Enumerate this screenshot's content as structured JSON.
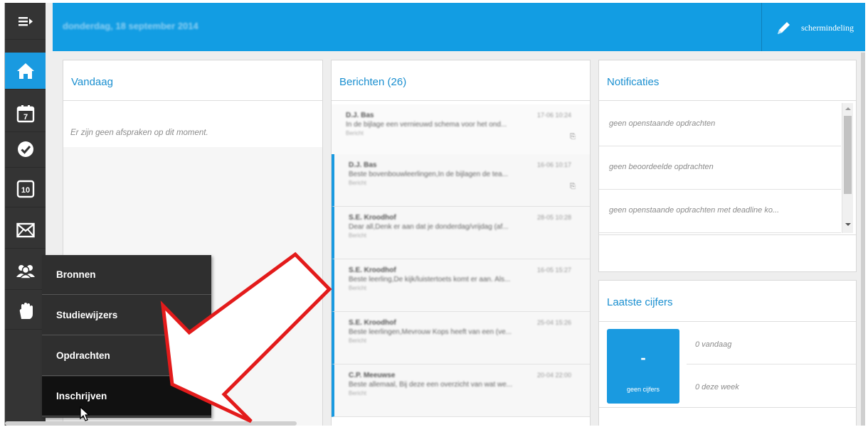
{
  "header": {
    "date": "donderdag, 18 september 2014",
    "split_label": "schermindeling"
  },
  "sidebar": {
    "items": [
      {
        "icon": "menu-expand-icon"
      },
      {
        "icon": "home-icon",
        "active": true
      },
      {
        "icon": "calendar-icon",
        "value": "7"
      },
      {
        "icon": "checkmark-icon"
      },
      {
        "icon": "grades-icon",
        "value": "10"
      },
      {
        "icon": "mail-icon"
      },
      {
        "icon": "people-icon"
      },
      {
        "icon": "hand-icon"
      }
    ]
  },
  "vandaag": {
    "title": "Vandaag",
    "empty": "Er zijn geen afspraken op dit moment."
  },
  "berichten": {
    "title": "Berichten (26)",
    "messages": [
      {
        "from": "D.J. Bas",
        "time": "17-06 10:24",
        "text": "In de bijlage een vernieuwd schema voor het ond...",
        "tag": "Bericht"
      },
      {
        "from": "D.J. Bas",
        "time": "16-06 10:17",
        "text": "Beste bovenbouwleerlingen,In de bijlagen de tea...",
        "tag": "Bericht"
      },
      {
        "from": "S.E. Kroodhof",
        "time": "28-05 10:28",
        "text": "Dear all,Denk er aan dat je donderdag/vrijdag (af...",
        "tag": "Bericht"
      },
      {
        "from": "S.E. Kroodhof",
        "time": "16-05 15:27",
        "text": "Beste leerling,De kijk/luistertoets komt er aan. Als...",
        "tag": "Bericht"
      },
      {
        "from": "S.E. Kroodhof",
        "time": "25-04 15:26",
        "text": "Beste leerlingen,Mevrouw Kops heeft van een (ve...",
        "tag": "Bericht"
      },
      {
        "from": "C.P. Meeuwse",
        "time": "20-04 22:00",
        "text": "Beste allemaal, Bij deze een overzicht van wat we...",
        "tag": "Bericht"
      }
    ]
  },
  "notificaties": {
    "title": "Notificaties",
    "items": [
      "geen openstaande opdrachten",
      "geen beoordeelde opdrachten",
      "geen openstaande opdrachten met deadline ko..."
    ]
  },
  "cijfers": {
    "title": "Laatste cijfers",
    "dash": "-",
    "tile_label": "geen cijfers",
    "today": "0 vandaag",
    "week": "0 deze week"
  },
  "menu": {
    "items": [
      "Bronnen",
      "Studiewijzers",
      "Opdrachten",
      "Inschrijven"
    ],
    "hovered": "Inschrijven"
  },
  "colors": {
    "accent": "#1a9ae0",
    "sidebar": "#343434",
    "arrow": "#e31b1b"
  }
}
